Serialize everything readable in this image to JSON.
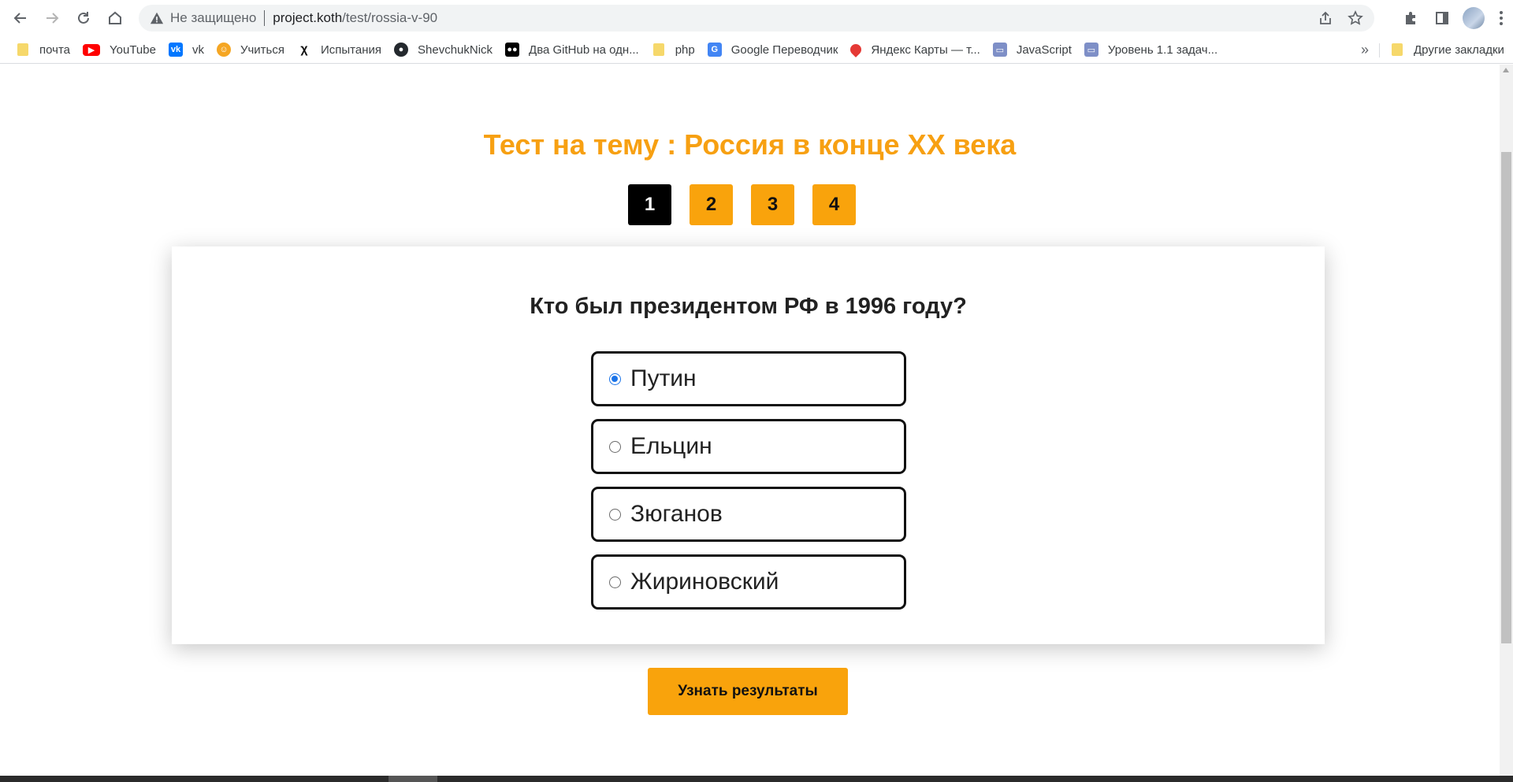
{
  "browser": {
    "security_text": "Не защищено",
    "url_host": "project.koth",
    "url_path": "/test/rossia-v-90"
  },
  "bookmarks": {
    "items": [
      {
        "label": "почта",
        "icon": "folder-icon"
      },
      {
        "label": "YouTube",
        "icon": "youtube-icon"
      },
      {
        "label": "vk",
        "icon": "vk-icon"
      },
      {
        "label": "Учиться",
        "icon": "lion-icon"
      },
      {
        "label": "Испытания",
        "icon": "x-icon"
      },
      {
        "label": "ShevchukNick",
        "icon": "github-icon"
      },
      {
        "label": "Два GitHub на одн...",
        "icon": "medium-icon"
      },
      {
        "label": "php",
        "icon": "folder-icon"
      },
      {
        "label": "Google Переводчик",
        "icon": "translate-icon"
      },
      {
        "label": "Яндекс Карты — т...",
        "icon": "map-pin-icon"
      },
      {
        "label": "JavaScript",
        "icon": "laptop-icon"
      },
      {
        "label": "Уровень 1.1 задач...",
        "icon": "laptop-icon"
      }
    ],
    "more": "»",
    "other": "Другие закладки"
  },
  "test": {
    "title": "Тест на тему : Россия в конце XX века",
    "pages": [
      "1",
      "2",
      "3",
      "4"
    ],
    "active_page": "1",
    "question": "Кто был президентом РФ в 1996 году?",
    "answers": [
      "Путин",
      "Ельцин",
      "Зюганов",
      "Жириновский"
    ],
    "selected_answer": "Путин",
    "results_button": "Узнать результаты"
  },
  "colors": {
    "accent": "#f9a30c",
    "title": "#f7a012",
    "radio_checked": "#1a73e8"
  }
}
